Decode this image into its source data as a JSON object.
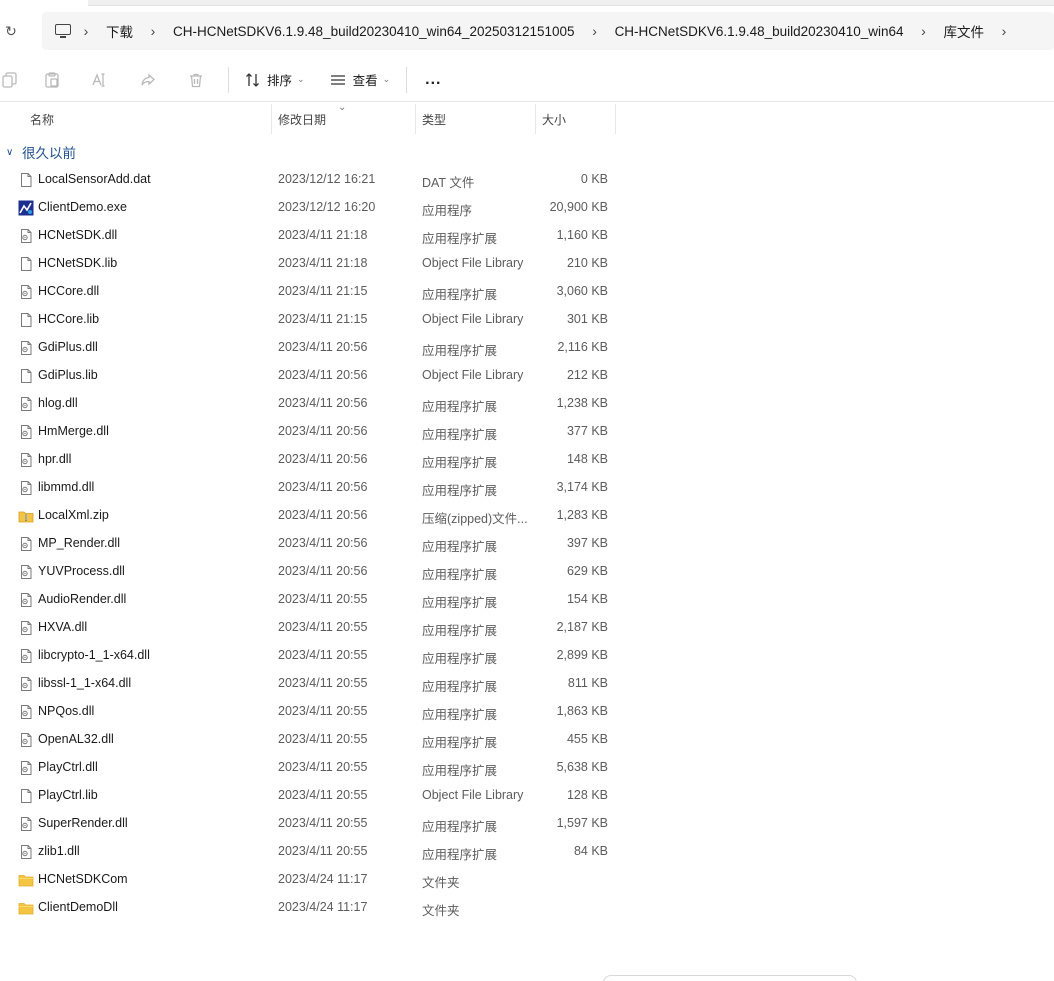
{
  "breadcrumb": {
    "items": [
      "下载",
      "CH-HCNetSDKV6.1.9.48_build20230410_win64_20250312151005",
      "CH-HCNetSDKV6.1.9.48_build20230410_win64",
      "库文件"
    ],
    "icons": [
      "refresh-icon",
      "monitor-icon",
      "chevron-right-icon"
    ]
  },
  "toolbar": {
    "sort_label": "排序",
    "view_label": "查看",
    "more_label": "...",
    "disabled_icons": [
      "copy-icon",
      "paste-icon",
      "rename-icon",
      "share-icon",
      "delete-icon"
    ]
  },
  "columns": {
    "name": "名称",
    "date": "修改日期",
    "type": "类型",
    "size": "大小"
  },
  "group": {
    "label": "很久以前"
  },
  "files": [
    {
      "name": "LocalSensorAdd.dat",
      "date": "2023/12/12 16:21",
      "type": "DAT 文件",
      "size": "0 KB",
      "icon": "file"
    },
    {
      "name": "ClientDemo.exe",
      "date": "2023/12/12 16:20",
      "type": "应用程序",
      "size": "20,900 KB",
      "icon": "exe"
    },
    {
      "name": "HCNetSDK.dll",
      "date": "2023/4/11 21:18",
      "type": "应用程序扩展",
      "size": "1,160 KB",
      "icon": "dll"
    },
    {
      "name": "HCNetSDK.lib",
      "date": "2023/4/11 21:18",
      "type": "Object File Library",
      "size": "210 KB",
      "icon": "file"
    },
    {
      "name": "HCCore.dll",
      "date": "2023/4/11 21:15",
      "type": "应用程序扩展",
      "size": "3,060 KB",
      "icon": "dll"
    },
    {
      "name": "HCCore.lib",
      "date": "2023/4/11 21:15",
      "type": "Object File Library",
      "size": "301 KB",
      "icon": "file"
    },
    {
      "name": "GdiPlus.dll",
      "date": "2023/4/11 20:56",
      "type": "应用程序扩展",
      "size": "2,116 KB",
      "icon": "dll"
    },
    {
      "name": "GdiPlus.lib",
      "date": "2023/4/11 20:56",
      "type": "Object File Library",
      "size": "212 KB",
      "icon": "file"
    },
    {
      "name": "hlog.dll",
      "date": "2023/4/11 20:56",
      "type": "应用程序扩展",
      "size": "1,238 KB",
      "icon": "dll"
    },
    {
      "name": "HmMerge.dll",
      "date": "2023/4/11 20:56",
      "type": "应用程序扩展",
      "size": "377 KB",
      "icon": "dll"
    },
    {
      "name": "hpr.dll",
      "date": "2023/4/11 20:56",
      "type": "应用程序扩展",
      "size": "148 KB",
      "icon": "dll"
    },
    {
      "name": "libmmd.dll",
      "date": "2023/4/11 20:56",
      "type": "应用程序扩展",
      "size": "3,174 KB",
      "icon": "dll"
    },
    {
      "name": "LocalXml.zip",
      "date": "2023/4/11 20:56",
      "type": "压缩(zipped)文件...",
      "size": "1,283 KB",
      "icon": "zip"
    },
    {
      "name": "MP_Render.dll",
      "date": "2023/4/11 20:56",
      "type": "应用程序扩展",
      "size": "397 KB",
      "icon": "dll"
    },
    {
      "name": "YUVProcess.dll",
      "date": "2023/4/11 20:56",
      "type": "应用程序扩展",
      "size": "629 KB",
      "icon": "dll"
    },
    {
      "name": "AudioRender.dll",
      "date": "2023/4/11 20:55",
      "type": "应用程序扩展",
      "size": "154 KB",
      "icon": "dll"
    },
    {
      "name": "HXVA.dll",
      "date": "2023/4/11 20:55",
      "type": "应用程序扩展",
      "size": "2,187 KB",
      "icon": "dll"
    },
    {
      "name": "libcrypto-1_1-x64.dll",
      "date": "2023/4/11 20:55",
      "type": "应用程序扩展",
      "size": "2,899 KB",
      "icon": "dll"
    },
    {
      "name": "libssl-1_1-x64.dll",
      "date": "2023/4/11 20:55",
      "type": "应用程序扩展",
      "size": "811 KB",
      "icon": "dll"
    },
    {
      "name": "NPQos.dll",
      "date": "2023/4/11 20:55",
      "type": "应用程序扩展",
      "size": "1,863 KB",
      "icon": "dll"
    },
    {
      "name": "OpenAL32.dll",
      "date": "2023/4/11 20:55",
      "type": "应用程序扩展",
      "size": "455 KB",
      "icon": "dll"
    },
    {
      "name": "PlayCtrl.dll",
      "date": "2023/4/11 20:55",
      "type": "应用程序扩展",
      "size": "5,638 KB",
      "icon": "dll"
    },
    {
      "name": "PlayCtrl.lib",
      "date": "2023/4/11 20:55",
      "type": "Object File Library",
      "size": "128 KB",
      "icon": "file"
    },
    {
      "name": "SuperRender.dll",
      "date": "2023/4/11 20:55",
      "type": "应用程序扩展",
      "size": "1,597 KB",
      "icon": "dll"
    },
    {
      "name": "zlib1.dll",
      "date": "2023/4/11 20:55",
      "type": "应用程序扩展",
      "size": "84 KB",
      "icon": "dll"
    },
    {
      "name": "HCNetSDKCom",
      "date": "2023/4/24 11:17",
      "type": "文件夹",
      "size": "",
      "icon": "folder"
    },
    {
      "name": "ClientDemoDll",
      "date": "2023/4/24 11:17",
      "type": "文件夹",
      "size": "",
      "icon": "folder"
    }
  ],
  "colors": {
    "group_label": "#1e4e8c",
    "folder": "#f4c542",
    "secondary_text": "#5c5c5c"
  }
}
